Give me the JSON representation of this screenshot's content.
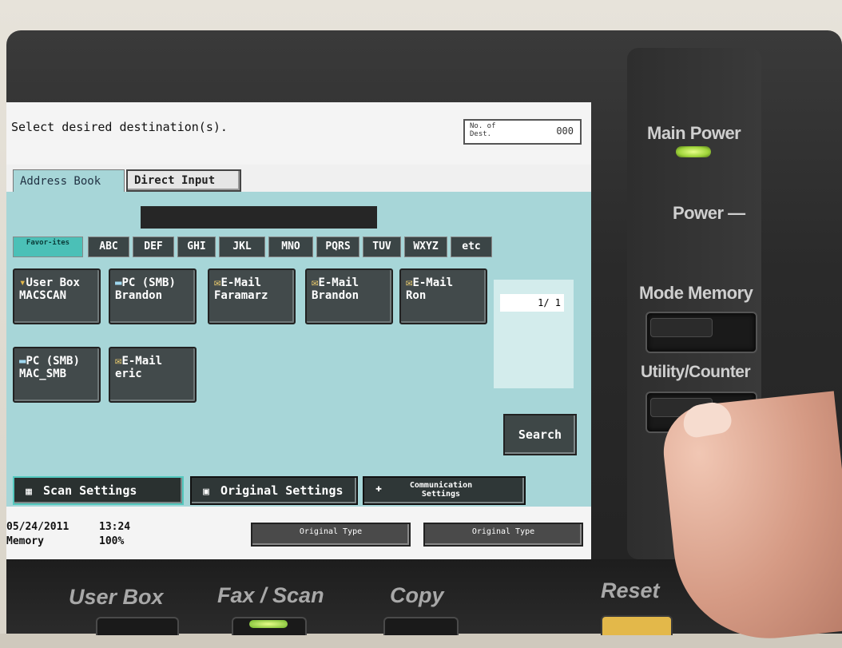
{
  "prompt": "Select desired destination(s).",
  "dest": {
    "label": "No. of Dest.",
    "count": "000"
  },
  "tabs": [
    {
      "label": "Address Book"
    },
    {
      "label": "Direct Input"
    }
  ],
  "index_buttons": [
    "Favor-ites",
    "ABC",
    "DEF",
    "GHI",
    "JKL",
    "MNO",
    "PQRS",
    "TUV",
    "WXYZ",
    "etc"
  ],
  "entries": [
    {
      "type": "User Box",
      "name": "MACSCAN",
      "icon": "folder-icon"
    },
    {
      "type": "PC (SMB)",
      "name": "Brandon",
      "icon": "pc-icon"
    },
    {
      "type": "E-Mail",
      "name": "Faramarz",
      "icon": "mail-icon"
    },
    {
      "type": "E-Mail",
      "name": "Brandon",
      "icon": "mail-icon"
    },
    {
      "type": "E-Mail",
      "name": "Ron",
      "icon": "mail-icon"
    },
    {
      "type": "PC (SMB)",
      "name": "MAC_SMB",
      "icon": "pc-icon"
    },
    {
      "type": "E-Mail",
      "name": "eric",
      "icon": "mail-icon"
    }
  ],
  "page": "1/  1",
  "search_label": "Search",
  "settings": {
    "scan": "Scan Settings",
    "original": "Original Settings",
    "communication": "Communication Settings"
  },
  "status": {
    "date": "05/24/2011",
    "time": "13:24",
    "memory_label": "Memory",
    "memory_value": "100%"
  },
  "original_type": [
    "Original Type",
    "Original Type"
  ],
  "hardware": {
    "main_power": "Main Power",
    "power": "Power",
    "mode_memory": "Mode Memory",
    "utility_counter": "Utility/Counter",
    "user_box": "User Box",
    "fax_scan": "Fax / Scan",
    "copy": "Copy",
    "reset": "Reset"
  },
  "colors": {
    "screen_teal": "#a7d6d8",
    "led_green": "#9fd43a"
  }
}
